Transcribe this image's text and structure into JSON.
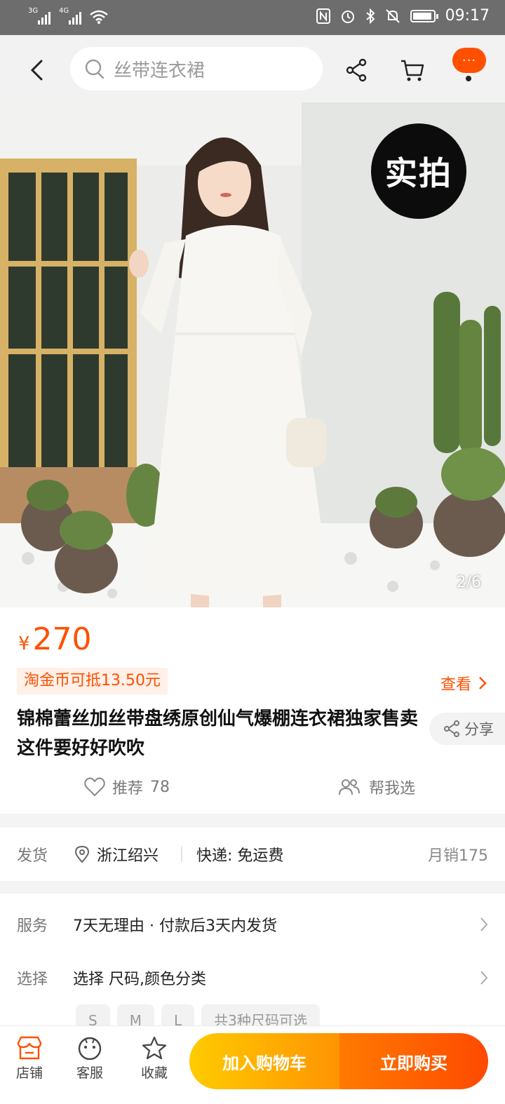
{
  "status_bar": {
    "network_1": "3G",
    "network_2": "4G",
    "time": "09:17"
  },
  "header": {
    "search_placeholder": "丝带连衣裙",
    "more_label": "···"
  },
  "gallery": {
    "badge": "实拍",
    "page_indicator": "2/6"
  },
  "product": {
    "currency": "¥",
    "price": "270",
    "coupon": "淘金币可抵13.50元",
    "view_label": "查看",
    "title": "锦棉蕾丝加丝带盘绣原创仙气爆棚连衣裙独家售卖这件要好好吹吹",
    "share_label": "分享",
    "recommend_label": "推荐",
    "recommend_count": "78",
    "help_choose": "帮我选"
  },
  "shipping": {
    "label": "发货",
    "location": "浙江绍兴",
    "express": "快递: 免运费",
    "monthly_sales": "月销175"
  },
  "services": {
    "service_label": "服务",
    "service_value": "7天无理由 · 付款后3天内发货",
    "select_label": "选择",
    "select_value": "选择 尺码,颜色分类",
    "size_chips": [
      "S",
      "M",
      "L"
    ],
    "size_summary": "共3种尺码可选"
  },
  "bottom_bar": {
    "shop": "店铺",
    "service": "客服",
    "favorite": "收藏",
    "add_to_cart": "加入购物车",
    "buy_now": "立即购买"
  },
  "colors": {
    "accent": "#ff5000",
    "cart_button": "#ffb000",
    "buy_button": "#ff5a00"
  }
}
